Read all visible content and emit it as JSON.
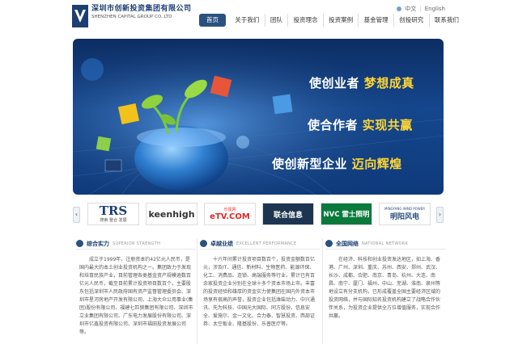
{
  "header": {
    "company_cn": "深圳市创新投资集团有限公司",
    "company_en": "SHENZHEN CAPITAL GROUP CO.,LTD",
    "lang_cn": "中文",
    "lang_en": "English"
  },
  "nav": {
    "items": [
      "首页",
      "关于我们",
      "团队",
      "投资理念",
      "投资案例",
      "基金管理",
      "创投研究",
      "联系我们"
    ]
  },
  "banner": {
    "slogan1_a": "使创业者",
    "slogan1_b": "梦想成真",
    "slogan2_a": "使合作者",
    "slogan2_b": "实现共赢",
    "slogan3_a": "使创新型企业",
    "slogan3_b": "迈向辉煌"
  },
  "partners": {
    "prev": "‹",
    "next": "›",
    "items": [
      {
        "name": "TRS",
        "sub": "搜索  整合  发展"
      },
      {
        "name": "keenhigh",
        "sub": ""
      },
      {
        "name": "eTV.COM",
        "sub": "乐视网"
      },
      {
        "name": "联合信息",
        "sub": ""
      },
      {
        "name": "NVC 雷士照明",
        "sub": ""
      },
      {
        "name": "明阳风电",
        "sub": "MINGYANG WIND POWER"
      }
    ]
  },
  "sections": [
    {
      "title": "综合实力",
      "subtitle": "SUPERIOR STRENGTH",
      "body": "成立于1999年，注册资本约42亿元人民币，是国内最大的本土创业投资机构之一。集团致力于发现和培育民族产业，目前管理各类基金资产规模逾数百亿元人民币，截至目前累计投资项目数百个。主要股东包括深圳市人民政府国有资产监督管理委员会、深圳市星河房地产开发有限公司、上海大众公用事业(集团)股份有限公司、福建七匹狼集团有限公司、深圳市立业集团有限公司、广东电力发展股份有限公司、深圳市亿鑫投资有限公司、深圳市福田投资发展公司等。"
    },
    {
      "title": "卓越业绩",
      "subtitle": "EXCELLENT PERFORMANCE",
      "body": "十六年间累计投资项目数百个，投资金额数百亿元，涉及IT、通信、新材料、生物医药、能源环保、化工、消费品、连锁、高端服务等行业，累计已有百余家投资企业分别在全球十多个资本市场上市。丰富的投资经验和雄厚的资金实力使集团在国内外资本市场享有很高的声誉，投资企业包括潍柴动力、中兴通讯、先为科技、中国光大国际、同方股份、信息安全、爱施尔、金一文化、合力泰、智慧投资、西部证券、太空板业、隆基股份、乐普医疗等。"
    },
    {
      "title": "全国网络",
      "subtitle": "NATIONAL NETWORK",
      "body": "在经济、科技和创业投资发达地区，如上海、香港、广州、深圳、重庆、苏州、西安、郑州、武汉、长沙、成都、合肥、南京、青岛、杭州、大连、南昌、南宁、厦门、福州、中山、芜湖、淮南、泉州等地设立有分支机构，已形成覆盖全国主要经济区域的投资网络，并与国际知名投资机构建立了战略合作伙伴关系，为投资企业提供全方位增值服务，实现合作共赢。"
    }
  ]
}
